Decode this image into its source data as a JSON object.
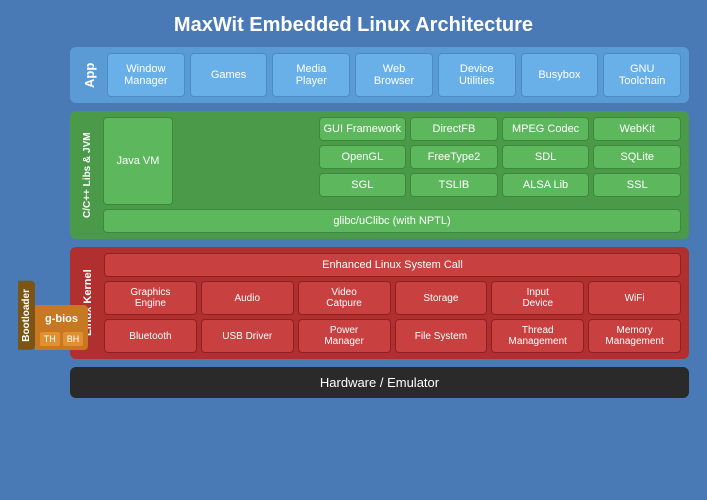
{
  "title": "MaxWit Embedded Linux Architecture",
  "app_layer": {
    "label": "App",
    "items": [
      {
        "id": "window-manager",
        "text": "Window\nManager"
      },
      {
        "id": "games",
        "text": "Games"
      },
      {
        "id": "media-player",
        "text": "Media\nPlayer"
      },
      {
        "id": "web-browser",
        "text": "Web\nBrowser"
      },
      {
        "id": "device-utilities",
        "text": "Device\nUtilities"
      },
      {
        "id": "busybox",
        "text": "Busybox"
      },
      {
        "id": "gnu-toolchain",
        "text": "GNU\nToolchain"
      }
    ]
  },
  "libs_layer": {
    "label": "C/C++ Libs & JVM",
    "row1": [
      {
        "id": "gui-framework",
        "text": "GUI Framework"
      },
      {
        "id": "directfb",
        "text": "DirectFB"
      },
      {
        "id": "mpeg-codec",
        "text": "MPEG Codec"
      },
      {
        "id": "webkit",
        "text": "WebKit"
      }
    ],
    "row2": [
      {
        "id": "opengl",
        "text": "OpenGL"
      },
      {
        "id": "freetype2",
        "text": "FreeType2"
      },
      {
        "id": "sdl",
        "text": "SDL"
      },
      {
        "id": "sqlite",
        "text": "SQLite"
      }
    ],
    "row3": [
      {
        "id": "sgl",
        "text": "SGL"
      },
      {
        "id": "tslib",
        "text": "TSLIB"
      },
      {
        "id": "alsa-lib",
        "text": "ALSA Lib"
      },
      {
        "id": "ssl",
        "text": "SSL"
      }
    ],
    "javavm": "Java VM",
    "glibc": "glibc/uClibc (with NPTL)"
  },
  "kernel_layer": {
    "label": "Linux Kernel",
    "syscall": "Enhanced Linux System Call",
    "items_row1": [
      {
        "id": "graphics-engine",
        "text": "Graphics\nEngine"
      },
      {
        "id": "audio",
        "text": "Audio"
      },
      {
        "id": "video-capture",
        "text": "Video\nCatpure"
      },
      {
        "id": "storage",
        "text": "Storage"
      },
      {
        "id": "input-device",
        "text": "Input\nDevice"
      },
      {
        "id": "wifi",
        "text": "WiFi"
      }
    ],
    "items_row2": [
      {
        "id": "bluetooth",
        "text": "Bluetooth"
      },
      {
        "id": "usb-driver",
        "text": "USB Driver"
      },
      {
        "id": "power-manager",
        "text": "Power\nManager"
      },
      {
        "id": "file-system",
        "text": "File System"
      },
      {
        "id": "thread-management",
        "text": "Thread\nManagement"
      },
      {
        "id": "memory-management",
        "text": "Memory\nManagement"
      }
    ]
  },
  "hardware_layer": {
    "text": "Hardware / Emulator"
  },
  "bootloader": {
    "label": "Bootloader",
    "gbios": "g-bios",
    "tags": [
      "TH",
      "BH"
    ]
  }
}
